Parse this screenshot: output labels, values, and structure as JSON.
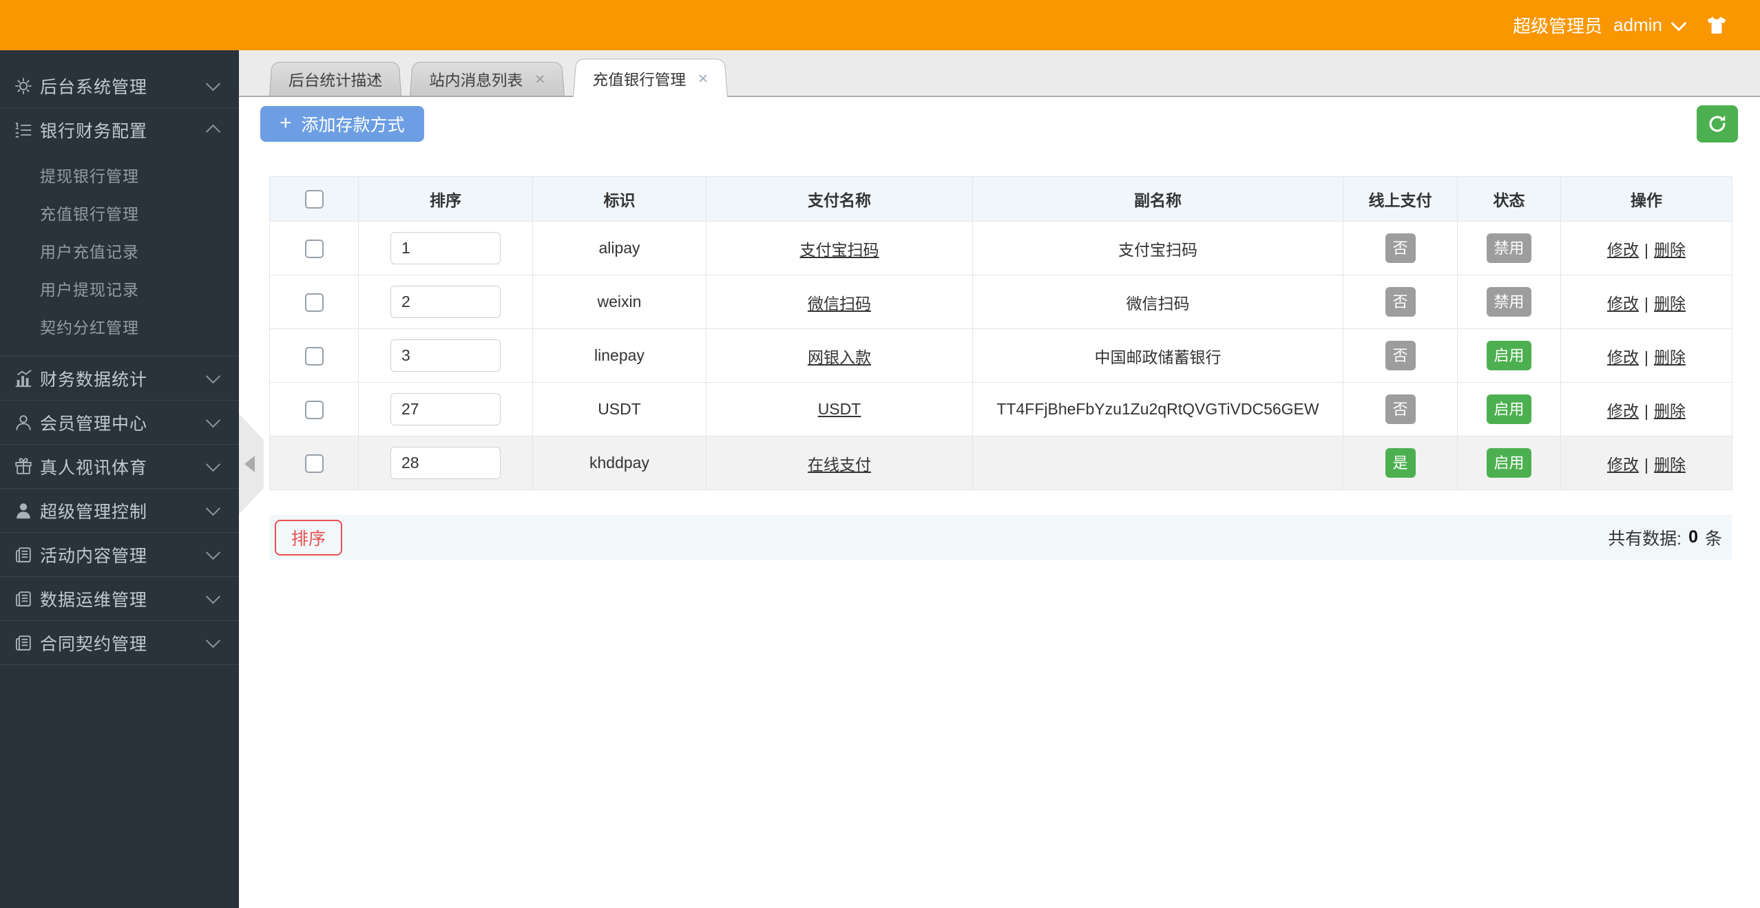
{
  "topbar": {
    "role_label": "超级管理员",
    "username": "admin"
  },
  "sidebar": {
    "items": [
      {
        "label": "后台系统管理"
      },
      {
        "label": "银行财务配置",
        "children": [
          "提现银行管理",
          "充值银行管理",
          "用户充值记录",
          "用户提现记录",
          "契约分红管理"
        ]
      },
      {
        "label": "财务数据统计"
      },
      {
        "label": "会员管理中心"
      },
      {
        "label": "真人视讯体育"
      },
      {
        "label": "超级管理控制"
      },
      {
        "label": "活动内容管理"
      },
      {
        "label": "数据运维管理"
      },
      {
        "label": "合同契约管理"
      }
    ]
  },
  "tabbar": {
    "close_glyph": "×",
    "tabs": [
      {
        "label": "后台统计描述"
      },
      {
        "label": "站内消息列表"
      },
      {
        "label": "充值银行管理"
      }
    ]
  },
  "toolbar": {
    "plus_glyph": "+",
    "add_label": "添加存款方式"
  },
  "table": {
    "columns": [
      "排序",
      "标识",
      "支付名称",
      "副名称",
      "线上支付",
      "状态",
      "操作"
    ],
    "actions": {
      "edit": "修改",
      "sep": "|",
      "delete": "删除"
    },
    "rows": [
      {
        "sort": "1",
        "code": "alipay",
        "name": "支付宝扫码",
        "subname": "支付宝扫码",
        "online": "否",
        "status": "禁用"
      },
      {
        "sort": "2",
        "code": "weixin",
        "name": "微信扫码",
        "subname": "微信扫码",
        "online": "否",
        "status": "禁用"
      },
      {
        "sort": "3",
        "code": "linepay",
        "name": "网银入款",
        "subname": "中国邮政储蓄银行",
        "online": "否",
        "status": "启用"
      },
      {
        "sort": "27",
        "code": "USDT",
        "name": "USDT",
        "subname": "TT4FFjBheFbYzu1Zu2qRtQVGTiVDC56GEW",
        "online": "否",
        "status": "启用"
      },
      {
        "sort": "28",
        "code": "khddpay",
        "name": "在线支付",
        "subname": "",
        "online": "是",
        "status": "启用"
      }
    ]
  },
  "footer": {
    "sort_button": "排序",
    "total_label": "共有数据:",
    "total_value": "0",
    "total_unit": "条"
  },
  "colors": {
    "topbar_orange": "#F99600",
    "sidebar_dark": "#2A323B",
    "button_blue": "#6D9EE3",
    "green": "#4DB050",
    "badge_gray": "#9D9D9D",
    "danger_red": "#E65050"
  }
}
